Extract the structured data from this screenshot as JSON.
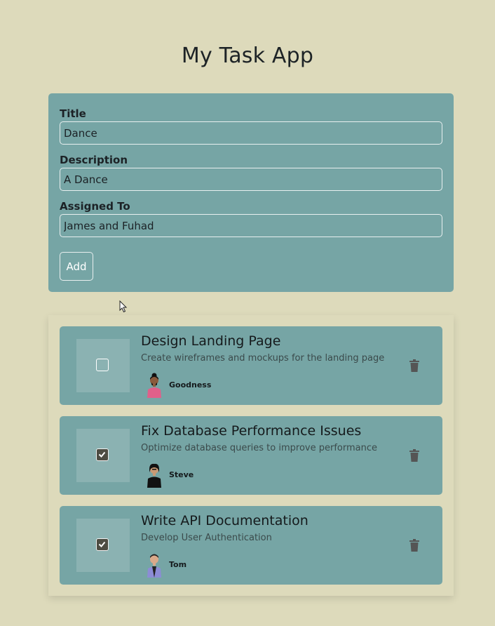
{
  "app": {
    "title": "My Task App"
  },
  "form": {
    "title_label": "Title",
    "title_value": "Dance",
    "description_label": "Description",
    "description_value": "A Dance",
    "assigned_label": "Assigned To",
    "assigned_value": "James and Fuhad",
    "add_label": "Add"
  },
  "tasks": [
    {
      "title": "Design Landing Page",
      "description": "Create wireframes and mockups for the landing page",
      "assignee": "Goodness",
      "completed": false
    },
    {
      "title": "Fix Database Performance Issues",
      "description": "Optimize database queries to improve performance",
      "assignee": "Steve",
      "completed": true
    },
    {
      "title": "Write API Documentation",
      "description": "Develop User Authentication",
      "assignee": "Tom",
      "completed": true
    }
  ],
  "colors": {
    "background": "#dddabb",
    "card": "#76a5a5",
    "checked": "#4d4c42",
    "trash": "#555555"
  },
  "icons": [
    "checkbox-icon",
    "check-icon",
    "trash-icon",
    "avatar-icon",
    "cursor-icon"
  ]
}
